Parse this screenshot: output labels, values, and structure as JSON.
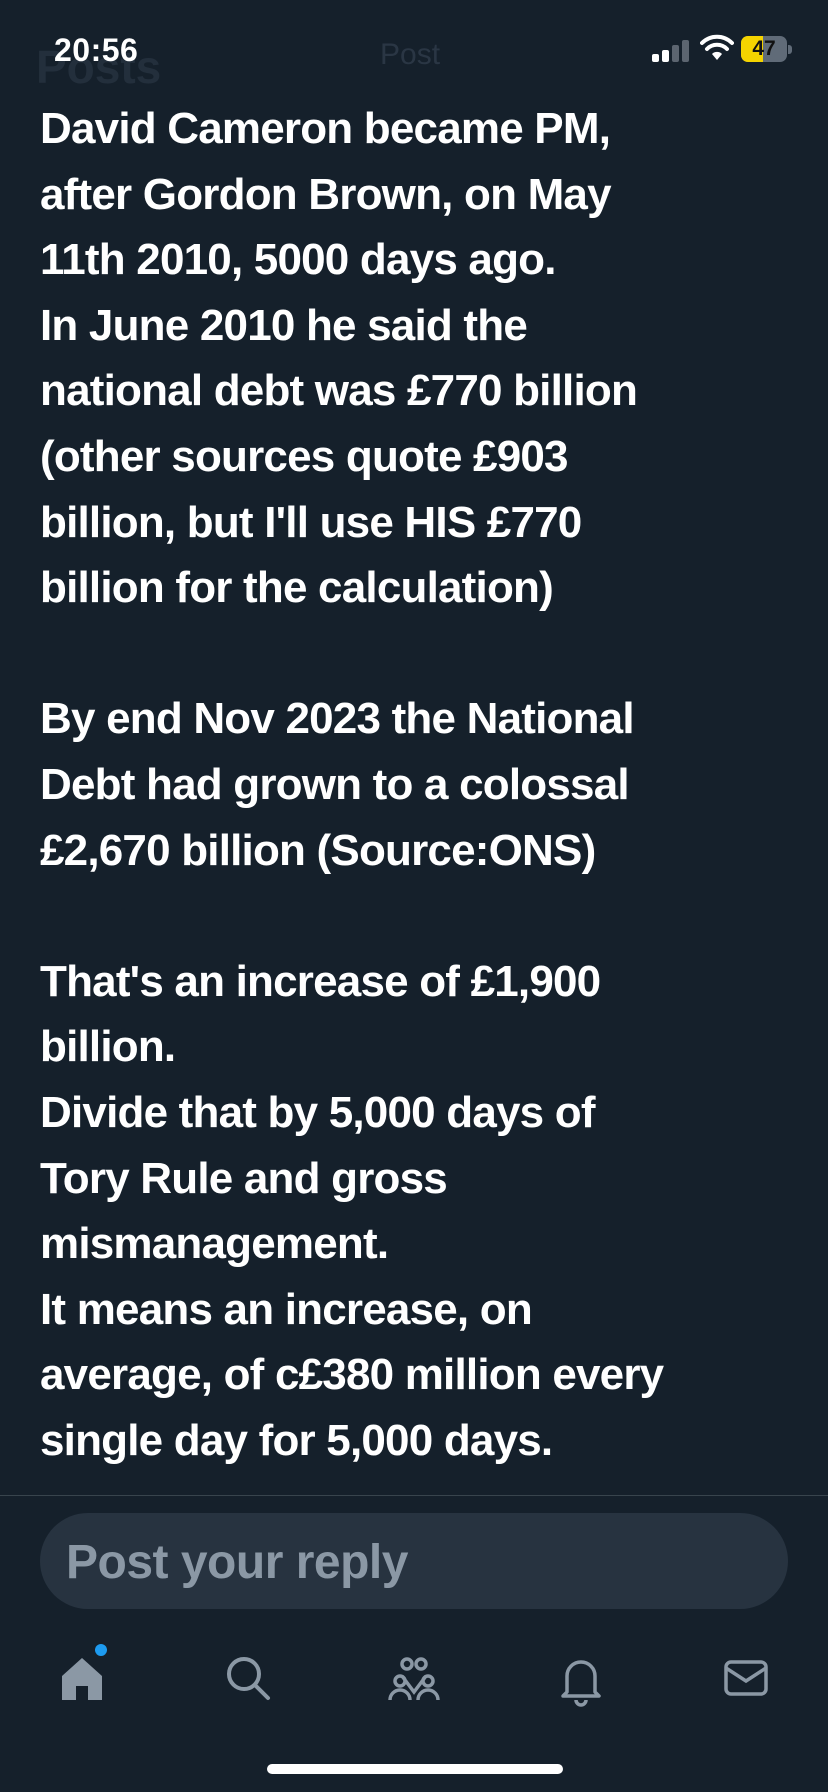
{
  "status_bar": {
    "time": "20:56",
    "battery_percent": "47",
    "battery_level": 0.47
  },
  "header": {
    "ghost_title": "Posts",
    "ghost_post": "Post"
  },
  "post": {
    "paragraphs": [
      "David Cameron became PM,\nafter Gordon Brown, on May\n11th 2010, 5000 days ago.\nIn June 2010 he said the\nnational debt was £770 billion\n(other sources quote £903\nbillion, but I'll use HIS £770\nbillion for the calculation)",
      "By end Nov 2023 the National\nDebt had grown to a colossal\n£2,670 billion (Source:ONS)",
      "That's an increase of £1,900\nbillion.\nDivide that by 5,000 days of\nTory Rule and gross\nmismanagement.\nIt means an increase, on\naverage, of c£380 million every\nsingle day for 5,000 days."
    ]
  },
  "reply": {
    "placeholder": "Post your reply"
  },
  "tabbar": {
    "items": [
      "home-icon",
      "search-icon",
      "communities-icon",
      "notifications-icon",
      "messages-icon"
    ],
    "accent_color": "#1d9bf0",
    "icon_color": "#8b98a5"
  }
}
